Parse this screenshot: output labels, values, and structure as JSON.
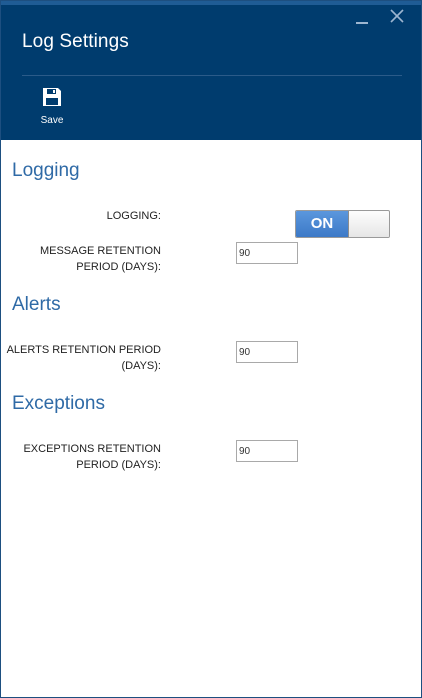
{
  "window": {
    "title": "Log Settings",
    "minimize_label": "minimize",
    "close_label": "close"
  },
  "toolbar": {
    "save_label": "Save",
    "save_icon": "floppy-disk-icon"
  },
  "sections": {
    "logging": {
      "title": "Logging",
      "logging_label": "LOGGING:",
      "logging_toggle_text": "ON",
      "logging_enabled": true,
      "message_retention_label_line1": "MESSAGE RETENTION",
      "message_retention_label_line2": "PERIOD (DAYS):",
      "message_retention_value": "90"
    },
    "alerts": {
      "title": "Alerts",
      "alerts_retention_label_line1": "ALERTS RETENTION PERIOD",
      "alerts_retention_label_line2": "(DAYS):",
      "alerts_retention_value": "90"
    },
    "exceptions": {
      "title": "Exceptions",
      "exceptions_retention_label_line1": "EXCEPTIONS RETENTION",
      "exceptions_retention_label_line2": "PERIOD (DAYS):",
      "exceptions_retention_value": "90"
    }
  },
  "colors": {
    "header_bg": "#003c6e",
    "section_title": "#2f6aa6",
    "toggle_on": "#3c79c7"
  }
}
